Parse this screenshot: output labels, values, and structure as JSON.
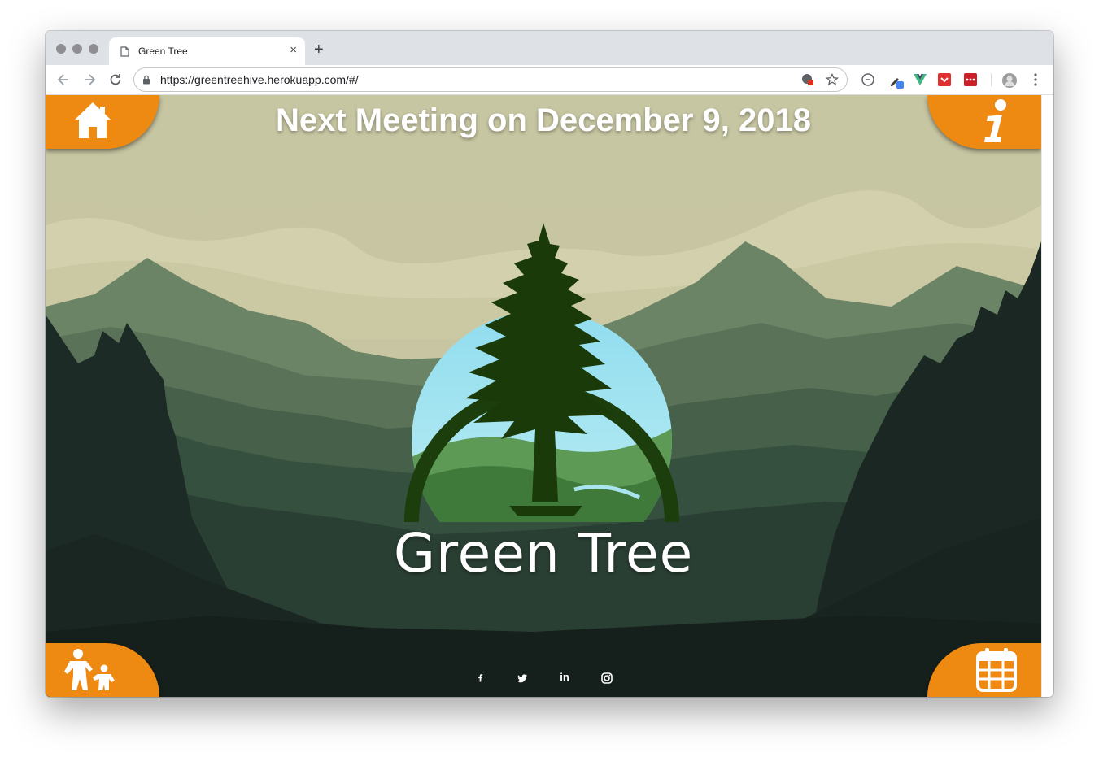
{
  "browser": {
    "tab_title": "Green Tree",
    "tab_close": "×",
    "new_tab": "+",
    "url": "https://greentreehive.herokuapp.com/#/"
  },
  "icons": {
    "home": "home-icon",
    "info": "info-icon",
    "family": "parent-child-icon",
    "calendar": "calendar-icon",
    "facebook": "facebook-icon",
    "twitter": "twitter-icon",
    "linkedin": "linkedin-icon",
    "instagram": "instagram-icon"
  },
  "page": {
    "headline": "Next Meeting on December 9, 2018",
    "brand_name": "Green Tree",
    "info_glyph": "i",
    "linkedin_glyph": "in"
  },
  "colors": {
    "accent_orange": "#ee8a12",
    "sky": "#c9c6a0",
    "forest_dark": "#172420",
    "logo_ring": "#1c3d0c"
  }
}
